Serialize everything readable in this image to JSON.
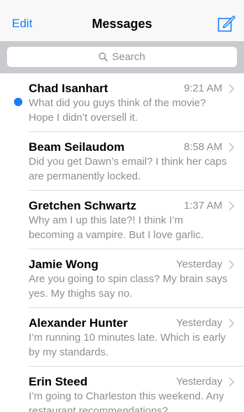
{
  "navbar": {
    "edit_label": "Edit",
    "title": "Messages",
    "compose_icon": "compose-icon"
  },
  "search": {
    "placeholder": "Search",
    "icon": "search-icon"
  },
  "colors": {
    "accent": "#147efb",
    "secondary_text": "#8e8e93",
    "search_background": "#c9c9ce"
  },
  "messages": [
    {
      "sender": "Chad Isanhart",
      "time": "9:21 AM",
      "unread": true,
      "preview": "What did you guys think of the movie? Hope I didn’t oversell it."
    },
    {
      "sender": "Beam Seilaudom",
      "time": "8:58 AM",
      "unread": false,
      "preview": "Did you get Dawn’s email? I think her caps are permanently locked."
    },
    {
      "sender": "Gretchen Schwartz",
      "time": "1:37 AM",
      "unread": false,
      "preview": "Why am I up this late?! I think I’m becoming a vampire. But I love garlic."
    },
    {
      "sender": "Jamie Wong",
      "time": "Yesterday",
      "unread": false,
      "preview": "Are you going to spin class? My brain says yes. My thighs say no."
    },
    {
      "sender": "Alexander Hunter",
      "time": "Yesterday",
      "unread": false,
      "preview": "I’m running 10 minutes late. Which is early by my standards."
    },
    {
      "sender": "Erin Steed",
      "time": "Yesterday",
      "unread": false,
      "preview": "I’m going to Charleston this weekend. Any restaurant recommendations?"
    }
  ]
}
